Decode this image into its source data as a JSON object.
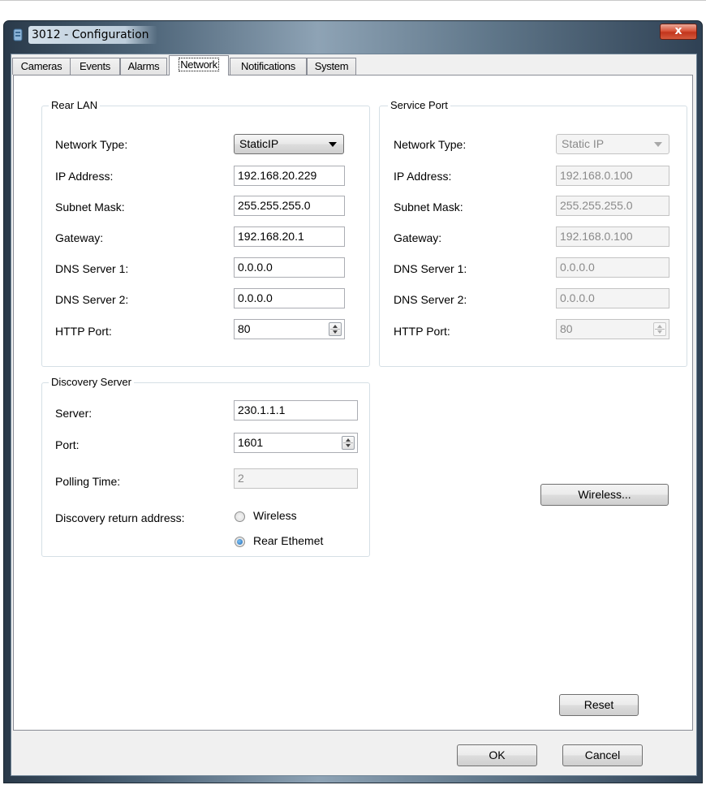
{
  "window": {
    "title": "3012 - Configuration",
    "close_glyph": "x"
  },
  "tabs": [
    {
      "label": "Cameras"
    },
    {
      "label": "Events"
    },
    {
      "label": "Alarms"
    },
    {
      "label": "Network"
    },
    {
      "label": "Notifications"
    },
    {
      "label": "System"
    }
  ],
  "active_tab": "Network",
  "rear_lan": {
    "legend": "Rear LAN",
    "network_type_label": "Network Type:",
    "network_type_value": "StaticIP",
    "ip_label": "IP Address:",
    "ip_value": "192.168.20.229",
    "subnet_label": "Subnet Mask:",
    "subnet_value": "255.255.255.0",
    "gateway_label": "Gateway:",
    "gateway_value": "192.168.20.1",
    "dns1_label": "DNS Server 1:",
    "dns1_value": "0.0.0.0",
    "dns2_label": "DNS Server 2:",
    "dns2_value": "0.0.0.0",
    "http_label": "HTTP Port:",
    "http_value": "80"
  },
  "service_port": {
    "legend": "Service Port",
    "network_type_label": "Network Type:",
    "network_type_value": "Static IP",
    "ip_label": "IP Address:",
    "ip_value": "192.168.0.100",
    "subnet_label": "Subnet Mask:",
    "subnet_value": "255.255.255.0",
    "gateway_label": "Gateway:",
    "gateway_value": "192.168.0.100",
    "dns1_label": "DNS Server 1:",
    "dns1_value": "0.0.0.0",
    "dns2_label": "DNS Server 2:",
    "dns2_value": "0.0.0.0",
    "http_label": "HTTP Port:",
    "http_value": "80"
  },
  "discovery": {
    "legend": "Discovery Server",
    "server_label": "Server:",
    "server_value": "230.1.1.1",
    "port_label": "Port:",
    "port_value": "1601",
    "polling_label": "Polling Time:",
    "polling_value": "2",
    "return_label": "Discovery return address:",
    "option_wireless": "Wireless",
    "option_rear": "Rear Ethemet",
    "selected": "Rear Ethemet"
  },
  "buttons": {
    "wireless": "Wireless...",
    "reset": "Reset",
    "ok": "OK",
    "cancel": "Cancel"
  },
  "colors": {
    "close_button": "#c2341c",
    "radio_selected": "#1d67b5",
    "disabled_text": "#8a8a8a"
  }
}
